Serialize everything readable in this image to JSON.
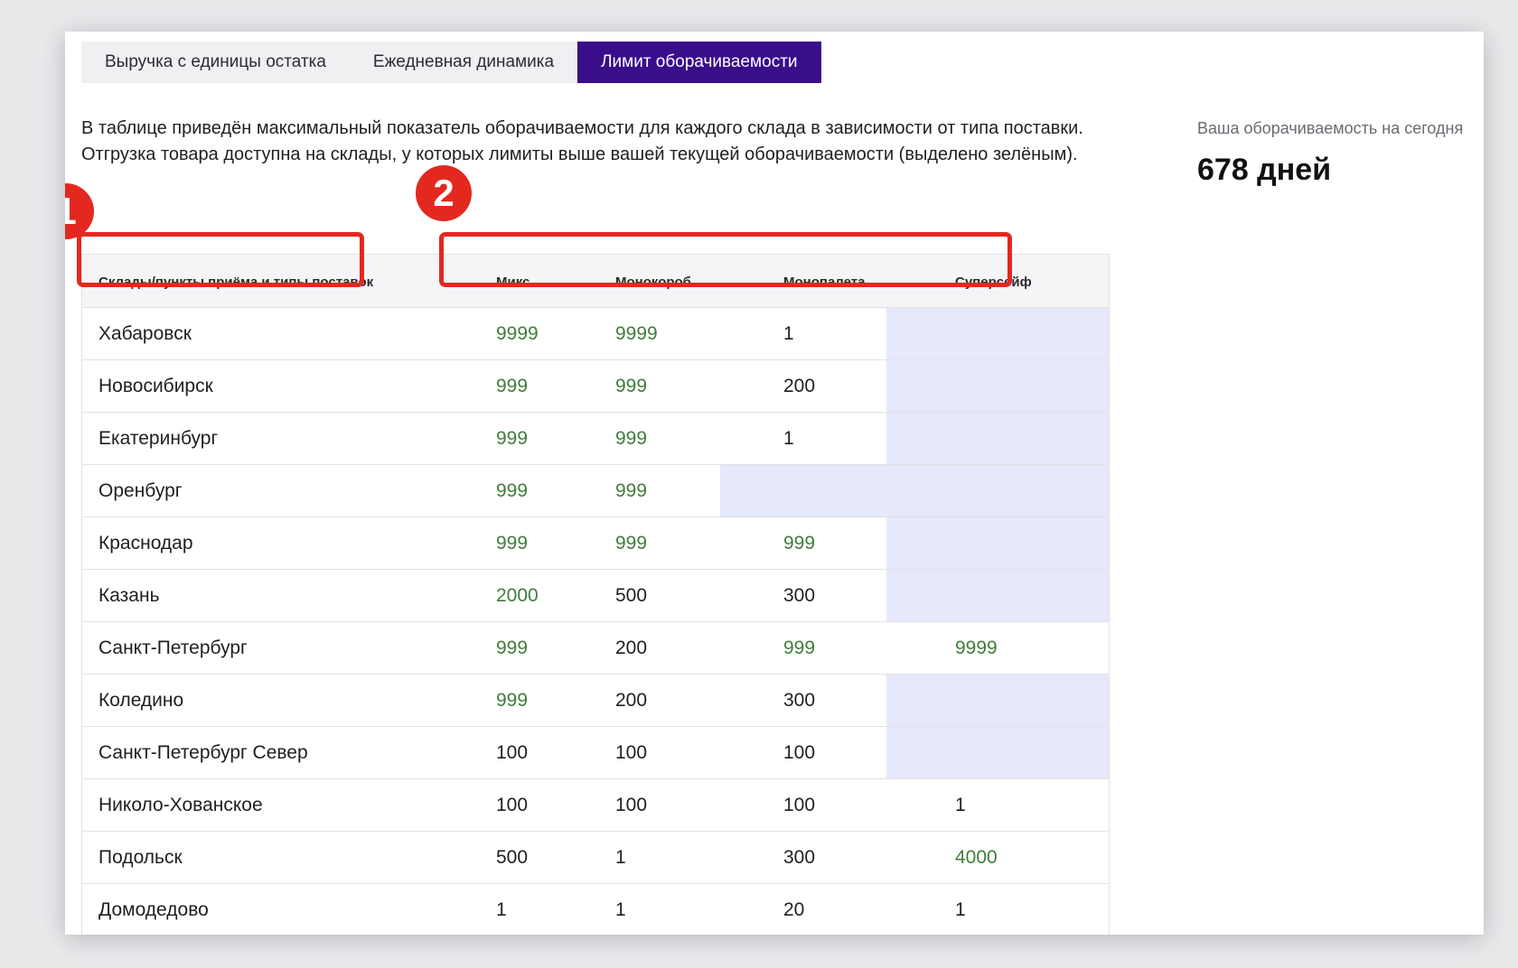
{
  "tabs": [
    {
      "label": "Выручка с единицы остатка",
      "active": false
    },
    {
      "label": "Ежедневная динамика",
      "active": false
    },
    {
      "label": "Лимит оборачиваемости",
      "active": true
    }
  ],
  "description": "В таблице приведён максимальный показатель оборачиваемости для каждого склада в зависимости от типа поставки. Отгрузка товара доступна на склады, у которых лимиты выше вашей текущей оборачиваемости (выделено зелёным).",
  "turnover": {
    "label": "Ваша оборачиваемость на сегодня",
    "value": "678 дней"
  },
  "table": {
    "headers": [
      "Склады/пункты приёма и типы поставок",
      "Микс",
      "Монокороб",
      "Монопалета",
      "Суперсейф"
    ],
    "rows": [
      {
        "name": "Хабаровск",
        "mix": "9999",
        "monobox": "9999",
        "monopallet": "1",
        "supersafe": ""
      },
      {
        "name": "Новосибирск",
        "mix": "999",
        "monobox": "999",
        "monopallet": "200",
        "supersafe": ""
      },
      {
        "name": "Екатеринбург",
        "mix": "999",
        "monobox": "999",
        "monopallet": "1",
        "supersafe": ""
      },
      {
        "name": "Оренбург",
        "mix": "999",
        "monobox": "999",
        "monopallet": "",
        "supersafe": ""
      },
      {
        "name": "Краснодар",
        "mix": "999",
        "monobox": "999",
        "monopallet": "999",
        "supersafe": ""
      },
      {
        "name": "Казань",
        "mix": "2000",
        "monobox": "500",
        "monopallet": "300",
        "supersafe": ""
      },
      {
        "name": "Санкт-Петербург",
        "mix": "999",
        "monobox": "200",
        "monopallet": "999",
        "supersafe": "9999"
      },
      {
        "name": "Коледино",
        "mix": "999",
        "monobox": "200",
        "monopallet": "300",
        "supersafe": ""
      },
      {
        "name": "Санкт-Петербург Север",
        "mix": "100",
        "monobox": "100",
        "monopallet": "100",
        "supersafe": ""
      },
      {
        "name": "Николо-Хованское",
        "mix": "100",
        "monobox": "100",
        "monopallet": "100",
        "supersafe": "1"
      },
      {
        "name": "Подольск",
        "mix": "500",
        "monobox": "1",
        "monopallet": "300",
        "supersafe": "4000"
      },
      {
        "name": "Домодедово",
        "mix": "1",
        "monobox": "1",
        "monopallet": "20",
        "supersafe": "1"
      }
    ]
  },
  "annotations": [
    {
      "label": "1"
    },
    {
      "label": "2"
    }
  ],
  "colors": {
    "active_tab": "#3a0d8a",
    "green_value": "#3f7d3a",
    "empty_cell": "#e6e8fb",
    "annotation": "#e3281f"
  }
}
